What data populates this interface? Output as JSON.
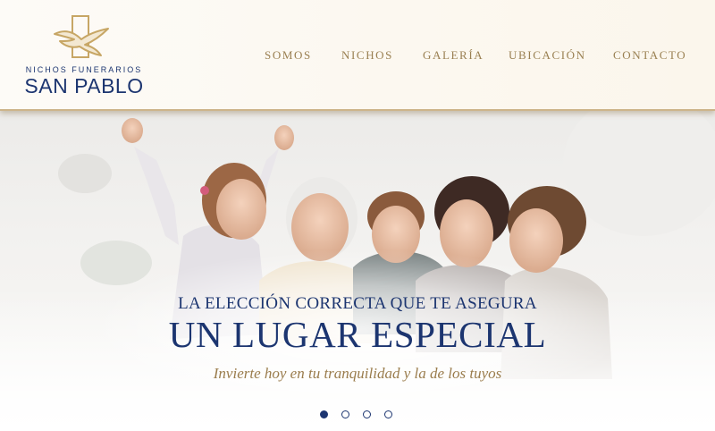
{
  "brand": {
    "subtitle": "NICHOS FUNERARIOS",
    "name": "SAN PABLO",
    "primary_color": "#1c3570",
    "accent_color": "#9a8052",
    "logo_icon": "dove-emblem-icon"
  },
  "nav": {
    "items": [
      {
        "label": "SOMOS"
      },
      {
        "label": "NICHOS"
      },
      {
        "label": "GALERÍA"
      },
      {
        "label": "UBICACIÓN"
      },
      {
        "label": "CONTACTO"
      }
    ]
  },
  "hero": {
    "tagline_top": "LA ELECCIÓN CORRECTA QUE TE ASEGURA",
    "tagline_main": "UN LUGAR ESPECIAL",
    "tagline_sub": "Invierte hoy en tu tranquilidad y la de los tuyos",
    "photo": "family-group-photo",
    "slides": {
      "count": 4,
      "active": 1
    }
  }
}
